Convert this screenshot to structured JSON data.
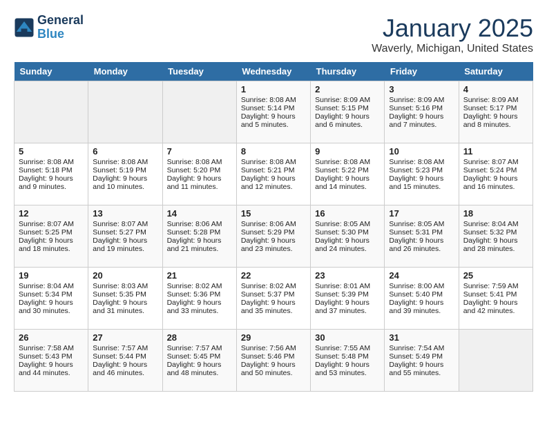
{
  "logo": {
    "line1": "General",
    "line2": "Blue"
  },
  "title": "January 2025",
  "location": "Waverly, Michigan, United States",
  "days_of_week": [
    "Sunday",
    "Monday",
    "Tuesday",
    "Wednesday",
    "Thursday",
    "Friday",
    "Saturday"
  ],
  "weeks": [
    [
      {
        "day": "",
        "sunrise": "",
        "sunset": "",
        "daylight": ""
      },
      {
        "day": "",
        "sunrise": "",
        "sunset": "",
        "daylight": ""
      },
      {
        "day": "",
        "sunrise": "",
        "sunset": "",
        "daylight": ""
      },
      {
        "day": "1",
        "sunrise": "Sunrise: 8:08 AM",
        "sunset": "Sunset: 5:14 PM",
        "daylight": "Daylight: 9 hours and 5 minutes."
      },
      {
        "day": "2",
        "sunrise": "Sunrise: 8:09 AM",
        "sunset": "Sunset: 5:15 PM",
        "daylight": "Daylight: 9 hours and 6 minutes."
      },
      {
        "day": "3",
        "sunrise": "Sunrise: 8:09 AM",
        "sunset": "Sunset: 5:16 PM",
        "daylight": "Daylight: 9 hours and 7 minutes."
      },
      {
        "day": "4",
        "sunrise": "Sunrise: 8:09 AM",
        "sunset": "Sunset: 5:17 PM",
        "daylight": "Daylight: 9 hours and 8 minutes."
      }
    ],
    [
      {
        "day": "5",
        "sunrise": "Sunrise: 8:08 AM",
        "sunset": "Sunset: 5:18 PM",
        "daylight": "Daylight: 9 hours and 9 minutes."
      },
      {
        "day": "6",
        "sunrise": "Sunrise: 8:08 AM",
        "sunset": "Sunset: 5:19 PM",
        "daylight": "Daylight: 9 hours and 10 minutes."
      },
      {
        "day": "7",
        "sunrise": "Sunrise: 8:08 AM",
        "sunset": "Sunset: 5:20 PM",
        "daylight": "Daylight: 9 hours and 11 minutes."
      },
      {
        "day": "8",
        "sunrise": "Sunrise: 8:08 AM",
        "sunset": "Sunset: 5:21 PM",
        "daylight": "Daylight: 9 hours and 12 minutes."
      },
      {
        "day": "9",
        "sunrise": "Sunrise: 8:08 AM",
        "sunset": "Sunset: 5:22 PM",
        "daylight": "Daylight: 9 hours and 14 minutes."
      },
      {
        "day": "10",
        "sunrise": "Sunrise: 8:08 AM",
        "sunset": "Sunset: 5:23 PM",
        "daylight": "Daylight: 9 hours and 15 minutes."
      },
      {
        "day": "11",
        "sunrise": "Sunrise: 8:07 AM",
        "sunset": "Sunset: 5:24 PM",
        "daylight": "Daylight: 9 hours and 16 minutes."
      }
    ],
    [
      {
        "day": "12",
        "sunrise": "Sunrise: 8:07 AM",
        "sunset": "Sunset: 5:25 PM",
        "daylight": "Daylight: 9 hours and 18 minutes."
      },
      {
        "day": "13",
        "sunrise": "Sunrise: 8:07 AM",
        "sunset": "Sunset: 5:27 PM",
        "daylight": "Daylight: 9 hours and 19 minutes."
      },
      {
        "day": "14",
        "sunrise": "Sunrise: 8:06 AM",
        "sunset": "Sunset: 5:28 PM",
        "daylight": "Daylight: 9 hours and 21 minutes."
      },
      {
        "day": "15",
        "sunrise": "Sunrise: 8:06 AM",
        "sunset": "Sunset: 5:29 PM",
        "daylight": "Daylight: 9 hours and 23 minutes."
      },
      {
        "day": "16",
        "sunrise": "Sunrise: 8:05 AM",
        "sunset": "Sunset: 5:30 PM",
        "daylight": "Daylight: 9 hours and 24 minutes."
      },
      {
        "day": "17",
        "sunrise": "Sunrise: 8:05 AM",
        "sunset": "Sunset: 5:31 PM",
        "daylight": "Daylight: 9 hours and 26 minutes."
      },
      {
        "day": "18",
        "sunrise": "Sunrise: 8:04 AM",
        "sunset": "Sunset: 5:32 PM",
        "daylight": "Daylight: 9 hours and 28 minutes."
      }
    ],
    [
      {
        "day": "19",
        "sunrise": "Sunrise: 8:04 AM",
        "sunset": "Sunset: 5:34 PM",
        "daylight": "Daylight: 9 hours and 30 minutes."
      },
      {
        "day": "20",
        "sunrise": "Sunrise: 8:03 AM",
        "sunset": "Sunset: 5:35 PM",
        "daylight": "Daylight: 9 hours and 31 minutes."
      },
      {
        "day": "21",
        "sunrise": "Sunrise: 8:02 AM",
        "sunset": "Sunset: 5:36 PM",
        "daylight": "Daylight: 9 hours and 33 minutes."
      },
      {
        "day": "22",
        "sunrise": "Sunrise: 8:02 AM",
        "sunset": "Sunset: 5:37 PM",
        "daylight": "Daylight: 9 hours and 35 minutes."
      },
      {
        "day": "23",
        "sunrise": "Sunrise: 8:01 AM",
        "sunset": "Sunset: 5:39 PM",
        "daylight": "Daylight: 9 hours and 37 minutes."
      },
      {
        "day": "24",
        "sunrise": "Sunrise: 8:00 AM",
        "sunset": "Sunset: 5:40 PM",
        "daylight": "Daylight: 9 hours and 39 minutes."
      },
      {
        "day": "25",
        "sunrise": "Sunrise: 7:59 AM",
        "sunset": "Sunset: 5:41 PM",
        "daylight": "Daylight: 9 hours and 42 minutes."
      }
    ],
    [
      {
        "day": "26",
        "sunrise": "Sunrise: 7:58 AM",
        "sunset": "Sunset: 5:43 PM",
        "daylight": "Daylight: 9 hours and 44 minutes."
      },
      {
        "day": "27",
        "sunrise": "Sunrise: 7:57 AM",
        "sunset": "Sunset: 5:44 PM",
        "daylight": "Daylight: 9 hours and 46 minutes."
      },
      {
        "day": "28",
        "sunrise": "Sunrise: 7:57 AM",
        "sunset": "Sunset: 5:45 PM",
        "daylight": "Daylight: 9 hours and 48 minutes."
      },
      {
        "day": "29",
        "sunrise": "Sunrise: 7:56 AM",
        "sunset": "Sunset: 5:46 PM",
        "daylight": "Daylight: 9 hours and 50 minutes."
      },
      {
        "day": "30",
        "sunrise": "Sunrise: 7:55 AM",
        "sunset": "Sunset: 5:48 PM",
        "daylight": "Daylight: 9 hours and 53 minutes."
      },
      {
        "day": "31",
        "sunrise": "Sunrise: 7:54 AM",
        "sunset": "Sunset: 5:49 PM",
        "daylight": "Daylight: 9 hours and 55 minutes."
      },
      {
        "day": "",
        "sunrise": "",
        "sunset": "",
        "daylight": ""
      }
    ]
  ]
}
